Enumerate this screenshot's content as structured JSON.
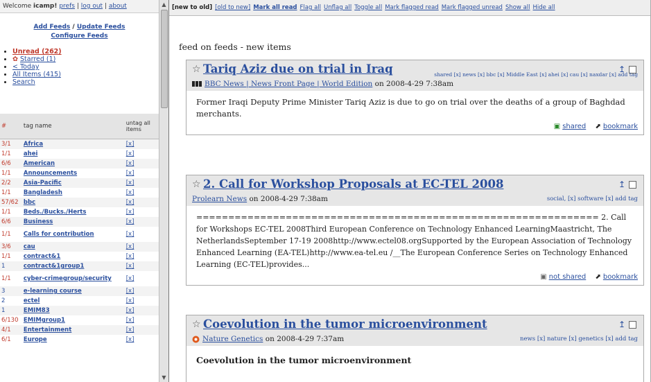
{
  "sidebar": {
    "welcome_prefix": "Welcome ",
    "username": "icamp",
    "welcome_suffix": "!",
    "links": [
      "prefs",
      "log out",
      "about"
    ],
    "add_feeds": "Add Feeds",
    "update_feeds": "Update Feeds",
    "configure_feeds": "Configure Feeds",
    "views": {
      "unread": "Unread (262)",
      "starred": "Starred (1)",
      "today": "< Today",
      "all": "All Items (415)",
      "search": "Search"
    },
    "table": {
      "col_count": "#",
      "col_tag": "tag name",
      "col_untag": "untag all items",
      "rows": [
        {
          "count": "3/1",
          "name": "Africa",
          "x": "[x]"
        },
        {
          "count": "1/1",
          "name": "ahei",
          "x": "[x]"
        },
        {
          "count": "6/6",
          "name": "American",
          "x": "[x]"
        },
        {
          "count": "1/1",
          "name": "Announcements",
          "x": "[x]"
        },
        {
          "count": "2/2",
          "name": "Asia-Pacific",
          "x": "[x]"
        },
        {
          "count": "1/1",
          "name": "Bangladesh",
          "x": "[x]"
        },
        {
          "count": "57/62",
          "name": "bbc",
          "x": "[x]"
        },
        {
          "count": "1/1",
          "name": "Beds./Bucks./Herts",
          "x": "[x]"
        },
        {
          "count": "6/6",
          "name": "Business",
          "x": "[x]"
        },
        {
          "count": "1/1",
          "name": "Calls for contribution",
          "x": "[x]"
        },
        {
          "count": "3/6",
          "name": "cau",
          "x": "[x]"
        },
        {
          "count": "1/1",
          "name": "contract&1",
          "x": "[x]"
        },
        {
          "count": "1",
          "name": "contract&1group1",
          "x": "[x]"
        },
        {
          "count": "1/1",
          "name": "cyber-crimegroup/security",
          "x": "[x]"
        },
        {
          "count": "3",
          "name": "e-learning course",
          "x": "[x]"
        },
        {
          "count": "2",
          "name": "ectel",
          "x": "[x]"
        },
        {
          "count": "1",
          "name": "EMIM83",
          "x": "[x]"
        },
        {
          "count": "6/130",
          "name": "EMIMgroup1",
          "x": "[x]"
        },
        {
          "count": "4/1",
          "name": "Entertainment",
          "x": "[x]"
        },
        {
          "count": "6/1",
          "name": "Europe",
          "x": "[x]"
        }
      ]
    }
  },
  "toolbar": {
    "items": [
      "[new to old]",
      "[old to new]",
      "Mark all read",
      "Flag all",
      "Unflag all",
      "Toggle all",
      "Mark flagged read",
      "Mark flagged unread",
      "Show all",
      "Hide all"
    ]
  },
  "page_title": "feed on feeds - new items",
  "items": [
    {
      "title": "Tariq Aziz due on trial in Iraq",
      "source": "BBC News | News Front Page | World Edition",
      "date": "on 2008-4-29 7:38am",
      "tags": "shared [x] news [x] bbc [x] Middle East [x] ahei [x] cau [x] naxdar [x] add tag",
      "body": "Former Iraqi Deputy Prime Minister Tariq Aziz is due to go on trial over the deaths of a group of Baghdad merchants.",
      "footer_share": "shared",
      "footer_bookmark": "bookmark"
    },
    {
      "title": "2. Call for Workshop Proposals at EC-TEL 2008",
      "source": "Prolearn News",
      "date": "on 2008-4-29 7:38am",
      "tags": "social, [x] software [x] add tag",
      "body": "=============================================================== 2. Call for Workshops EC-TEL 2008Third European Conference on Technology Enhanced LearningMaastricht, The NetherlandsSeptember 17-19 2008http://www.ectel08.orgSupported by the European Association of Technology Enhanced Learning (EA-TEL)http://www.ea-tel.eu /__The European Conference Series on Technology Enhanced Learning (EC-TEL)provides...",
      "footer_share": "not shared",
      "footer_bookmark": "bookmark"
    },
    {
      "title": "Coevolution in the tumor microenvironment",
      "source": "Nature Genetics",
      "date": "on 2008-4-29 7:37am",
      "tags": "news [x] nature [x] genetics [x] add tag",
      "body_heading": "Coevolution in the tumor microenvironment"
    }
  ],
  "colors": {
    "link": "#2a4f9e",
    "unread": "#c0392b",
    "header_bg": "#e6e6e6"
  }
}
